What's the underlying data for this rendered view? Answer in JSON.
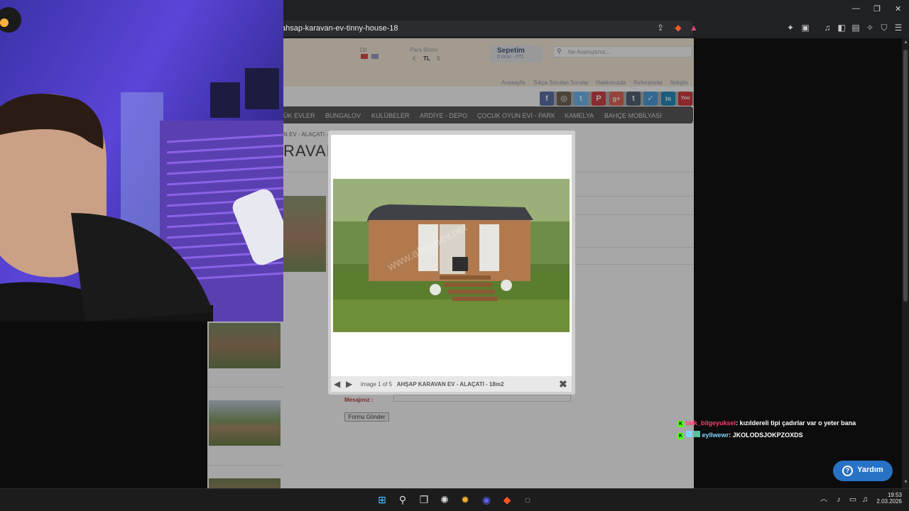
{
  "browser": {
    "url": "ahsap-karavan-ev-tinny-house-18",
    "window_controls": [
      "—",
      "❐",
      "✕"
    ]
  },
  "site": {
    "dil_label": "Dil",
    "para_birimi_label": "Para Birimi",
    "currency_options": [
      "€",
      "TL",
      "$"
    ],
    "cart_title": "Sepetim",
    "cart_sub": "0 ürün - 0TL",
    "search_placeholder": "Ne Aramıştınız...",
    "top_links": [
      "Anasayfa",
      "Sıkça Sorulan Sorular",
      "Hakkımızda",
      "Referanslar",
      "İletişim"
    ],
    "social": [
      {
        "name": "facebook-icon",
        "glyph": "f",
        "color": "#3b5998"
      },
      {
        "name": "instagram-icon",
        "glyph": "◎",
        "color": "#5b4a3a"
      },
      {
        "name": "twitter-icon",
        "glyph": "t",
        "color": "#55acee"
      },
      {
        "name": "pinterest-icon",
        "glyph": "P",
        "color": "#cb2027"
      },
      {
        "name": "googleplus-icon",
        "glyph": "g+",
        "color": "#dd4b39"
      },
      {
        "name": "tumblr-icon",
        "glyph": "t",
        "color": "#35465c"
      },
      {
        "name": "foursquare-icon",
        "glyph": "✓",
        "color": "#2d8fd5"
      },
      {
        "name": "linkedin-icon",
        "glyph": "in",
        "color": "#0077b5"
      },
      {
        "name": "youtube-icon",
        "glyph": "You",
        "color": "#cc181e"
      }
    ],
    "nav": [
      "ÜK EVLER",
      "BUNGALOV",
      "KULÜBELER",
      "ARDİYE - DEPO",
      "ÇOCUK OYUN EVİ - PARK",
      "KAMELYA",
      "BAHÇE MOBİLYASI"
    ],
    "breadcrumb": "N EV - ALAÇATI -",
    "product_title_partial": "RAVAI",
    "form_label": "Mesajınız :",
    "submit_label": "Formu Gönder"
  },
  "lightbox": {
    "counter": "image 1 of 5",
    "caption": "AHŞAP KARAVAN EV - ALAÇATI - 18m2",
    "watermark": "www.ahsapev.net"
  },
  "chat": [
    {
      "user": "tark_bilgeyuksel",
      "message": ": kızıldereli tipi çadırlar var o yeter bana",
      "color": "#ff3c6e"
    },
    {
      "user": "eyllwewr",
      "message": ": JKOLODSJOKPZOXDS",
      "color": "#7fd3ff"
    }
  ],
  "help_button": "Yardım",
  "taskbar": {
    "time": "19:53",
    "date": "2.03.2026"
  }
}
